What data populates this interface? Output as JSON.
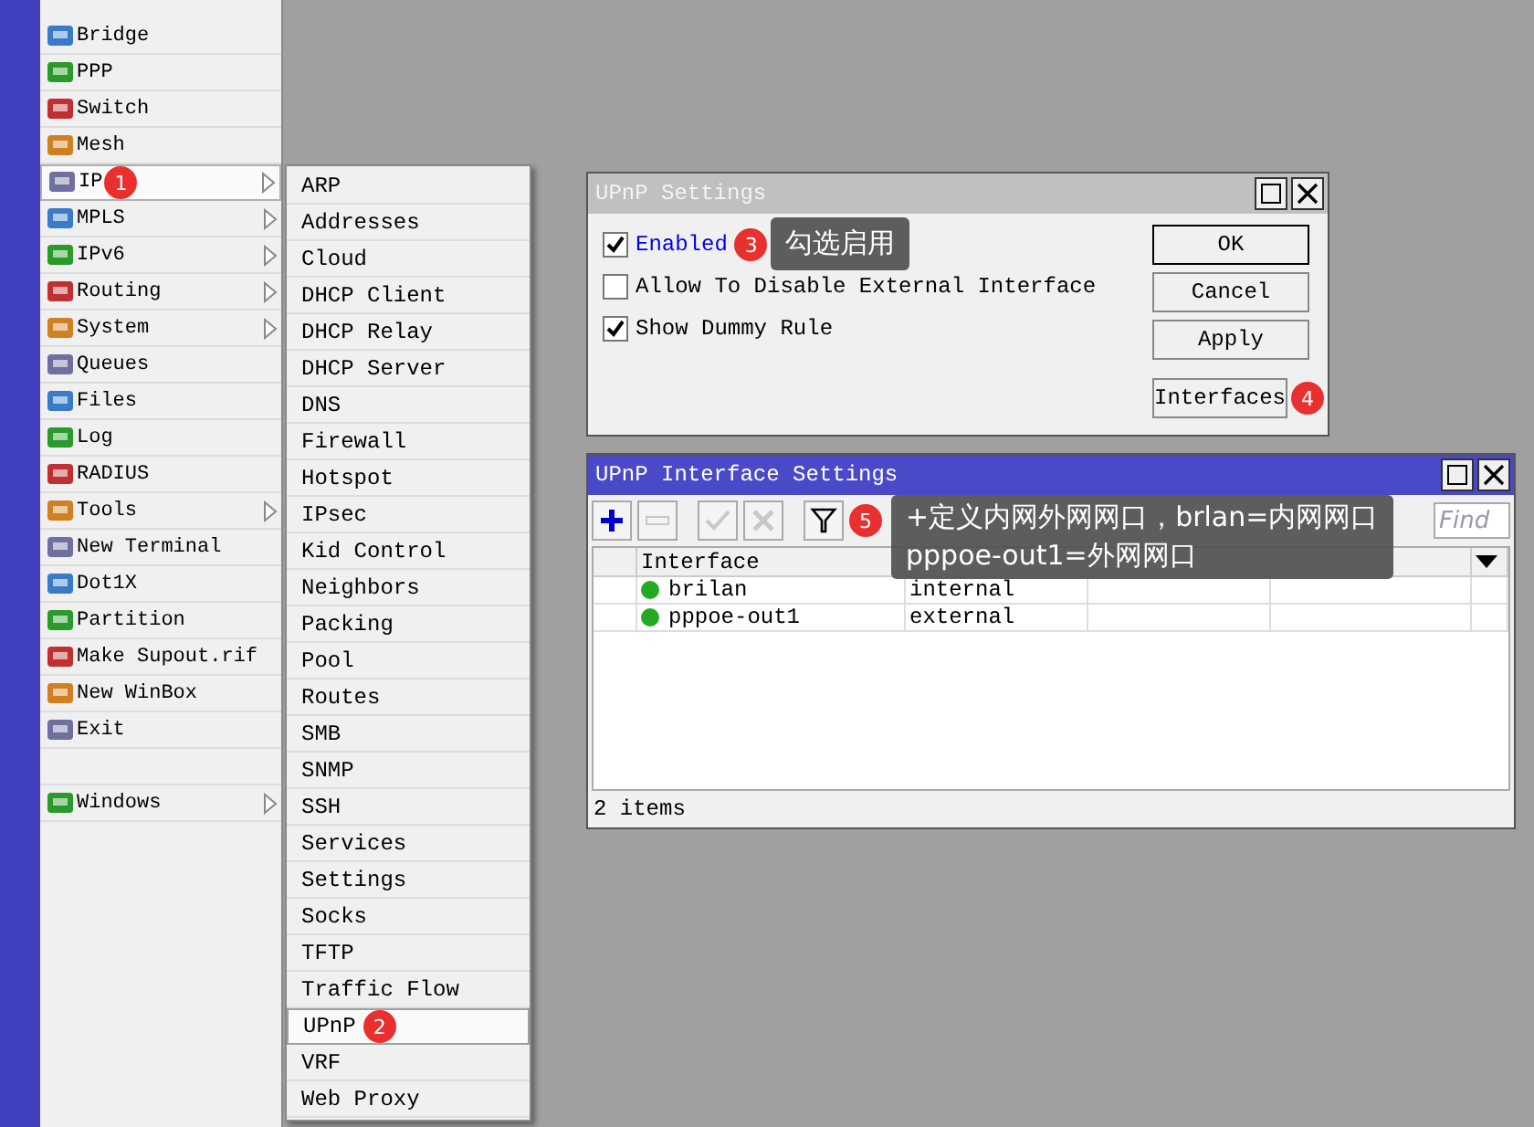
{
  "main_menu": {
    "items": [
      {
        "kind": "item",
        "label": "Bridge",
        "has_submenu": false,
        "selected": false
      },
      {
        "kind": "item",
        "label": "PPP",
        "has_submenu": false,
        "selected": false
      },
      {
        "kind": "item",
        "label": "Switch",
        "has_submenu": false,
        "selected": false
      },
      {
        "kind": "item",
        "label": "Mesh",
        "has_submenu": false,
        "selected": false
      },
      {
        "kind": "item",
        "label": "IP",
        "has_submenu": true,
        "selected": true,
        "badge": "1"
      },
      {
        "kind": "item",
        "label": "MPLS",
        "has_submenu": true,
        "selected": false
      },
      {
        "kind": "item",
        "label": "IPv6",
        "has_submenu": true,
        "selected": false
      },
      {
        "kind": "item",
        "label": "Routing",
        "has_submenu": true,
        "selected": false
      },
      {
        "kind": "item",
        "label": "System",
        "has_submenu": true,
        "selected": false
      },
      {
        "kind": "item",
        "label": "Queues",
        "has_submenu": false,
        "selected": false
      },
      {
        "kind": "item",
        "label": "Files",
        "has_submenu": false,
        "selected": false
      },
      {
        "kind": "item",
        "label": "Log",
        "has_submenu": false,
        "selected": false
      },
      {
        "kind": "item",
        "label": "RADIUS",
        "has_submenu": false,
        "selected": false
      },
      {
        "kind": "item",
        "label": "Tools",
        "has_submenu": true,
        "selected": false
      },
      {
        "kind": "item",
        "label": "New Terminal",
        "has_submenu": false,
        "selected": false
      },
      {
        "kind": "item",
        "label": "Dot1X",
        "has_submenu": false,
        "selected": false
      },
      {
        "kind": "item",
        "label": "Partition",
        "has_submenu": false,
        "selected": false
      },
      {
        "kind": "item",
        "label": "Make Supout.rif",
        "has_submenu": false,
        "selected": false
      },
      {
        "kind": "item",
        "label": "New WinBox",
        "has_submenu": false,
        "selected": false
      },
      {
        "kind": "item",
        "label": "Exit",
        "has_submenu": false,
        "selected": false
      },
      {
        "kind": "spacer"
      },
      {
        "kind": "item",
        "label": "Windows",
        "has_submenu": true,
        "selected": false
      }
    ]
  },
  "ip_submenu": {
    "items": [
      {
        "label": "ARP",
        "selected": false
      },
      {
        "label": "Addresses",
        "selected": false
      },
      {
        "label": "Cloud",
        "selected": false
      },
      {
        "label": "DHCP Client",
        "selected": false
      },
      {
        "label": "DHCP Relay",
        "selected": false
      },
      {
        "label": "DHCP Server",
        "selected": false
      },
      {
        "label": "DNS",
        "selected": false
      },
      {
        "label": "Firewall",
        "selected": false
      },
      {
        "label": "Hotspot",
        "selected": false
      },
      {
        "label": "IPsec",
        "selected": false
      },
      {
        "label": "Kid Control",
        "selected": false
      },
      {
        "label": "Neighbors",
        "selected": false
      },
      {
        "label": "Packing",
        "selected": false
      },
      {
        "label": "Pool",
        "selected": false
      },
      {
        "label": "Routes",
        "selected": false
      },
      {
        "label": "SMB",
        "selected": false
      },
      {
        "label": "SNMP",
        "selected": false
      },
      {
        "label": "SSH",
        "selected": false
      },
      {
        "label": "Services",
        "selected": false
      },
      {
        "label": "Settings",
        "selected": false
      },
      {
        "label": "Socks",
        "selected": false
      },
      {
        "label": "TFTP",
        "selected": false
      },
      {
        "label": "Traffic Flow",
        "selected": false
      },
      {
        "label": "UPnP",
        "selected": true,
        "badge": "2"
      },
      {
        "label": "VRF",
        "selected": false
      },
      {
        "label": "Web Proxy",
        "selected": false
      }
    ]
  },
  "settings_window": {
    "title": "UPnP Settings",
    "active": false,
    "options": [
      {
        "label": "Enabled",
        "checked": true,
        "focused": true,
        "badge": "3",
        "tooltip": "勾选启用"
      },
      {
        "label": "Allow To Disable External Interface",
        "checked": false,
        "focused": false
      },
      {
        "label": "Show Dummy Rule",
        "checked": true,
        "focused": false
      }
    ],
    "buttons": [
      {
        "label": "OK",
        "default": true
      },
      {
        "label": "Cancel",
        "default": false
      },
      {
        "label": "Apply",
        "default": false
      },
      {
        "label": "Interfaces",
        "default": false,
        "badge": "4"
      }
    ]
  },
  "interface_window": {
    "title": "UPnP Interface Settings",
    "active": true,
    "toolbar": [
      {
        "kind": "add",
        "disabled": false
      },
      {
        "kind": "remove",
        "disabled": true
      },
      {
        "kind": "enable",
        "disabled": true
      },
      {
        "kind": "disable",
        "disabled": true
      },
      {
        "kind": "filter",
        "disabled": false,
        "badge": "5",
        "tooltip": [
          "+定义内网外网网口，brlan=内网网口",
          "pppoe-out1=外网网口"
        ]
      }
    ],
    "search": {
      "placeholder": "Find"
    },
    "table": {
      "columns": [
        "Interface"
      ],
      "rows": [
        {
          "interface": "brilan",
          "type": "internal",
          "running": true
        },
        {
          "interface": "pppoe-out1",
          "type": "external",
          "running": true
        }
      ]
    },
    "status_bar": "2 items"
  }
}
